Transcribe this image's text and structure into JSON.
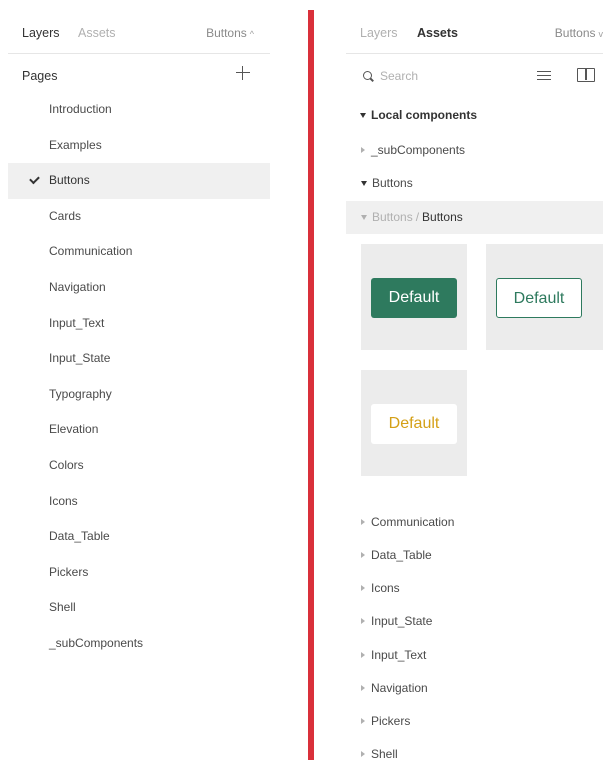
{
  "left_panel": {
    "tabs": {
      "layers": "Layers",
      "assets": "Assets"
    },
    "page_switch": {
      "label": "Buttons",
      "chevron": "^"
    },
    "pages_title": "Pages",
    "add_icon": "plus-icon",
    "pages": [
      "Introduction",
      "Examples",
      "Buttons",
      "Cards",
      "Communication",
      "Navigation",
      "Input_Text",
      "Input_State",
      "Typography",
      "Elevation",
      "Colors",
      "Icons",
      "Data_Table",
      "Pickers",
      "Shell",
      "_subComponents"
    ],
    "selected_page": "Buttons"
  },
  "right_panel": {
    "tabs": {
      "layers": "Layers",
      "assets": "Assets"
    },
    "page_switch": {
      "label": "Buttons",
      "chevron": "v"
    },
    "search": {
      "placeholder": "Search",
      "value": ""
    },
    "icons": {
      "list": "list-view-icon",
      "library": "book-icon"
    },
    "section_title": "Local components",
    "groups_top": [
      {
        "label": "_subComponents",
        "expanded": false
      },
      {
        "label": "Buttons",
        "expanded": true
      }
    ],
    "path": {
      "parent": "Buttons",
      "separator": "/",
      "current": "Buttons"
    },
    "thumbnails": [
      {
        "label": "Default",
        "variant": "primary"
      },
      {
        "label": "Default",
        "variant": "secondary"
      },
      {
        "label": "Default",
        "variant": "tertiary"
      }
    ],
    "groups_bottom": [
      "Communication",
      "Data_Table",
      "Icons",
      "Input_State",
      "Input_Text",
      "Navigation",
      "Pickers",
      "Shell"
    ]
  },
  "colors": {
    "divider": "#d9303a",
    "primary_green": "#2e7a5e",
    "tertiary_gold": "#d4a017",
    "selected_bg": "#f0f0f0",
    "thumb_bg": "#ececec"
  }
}
